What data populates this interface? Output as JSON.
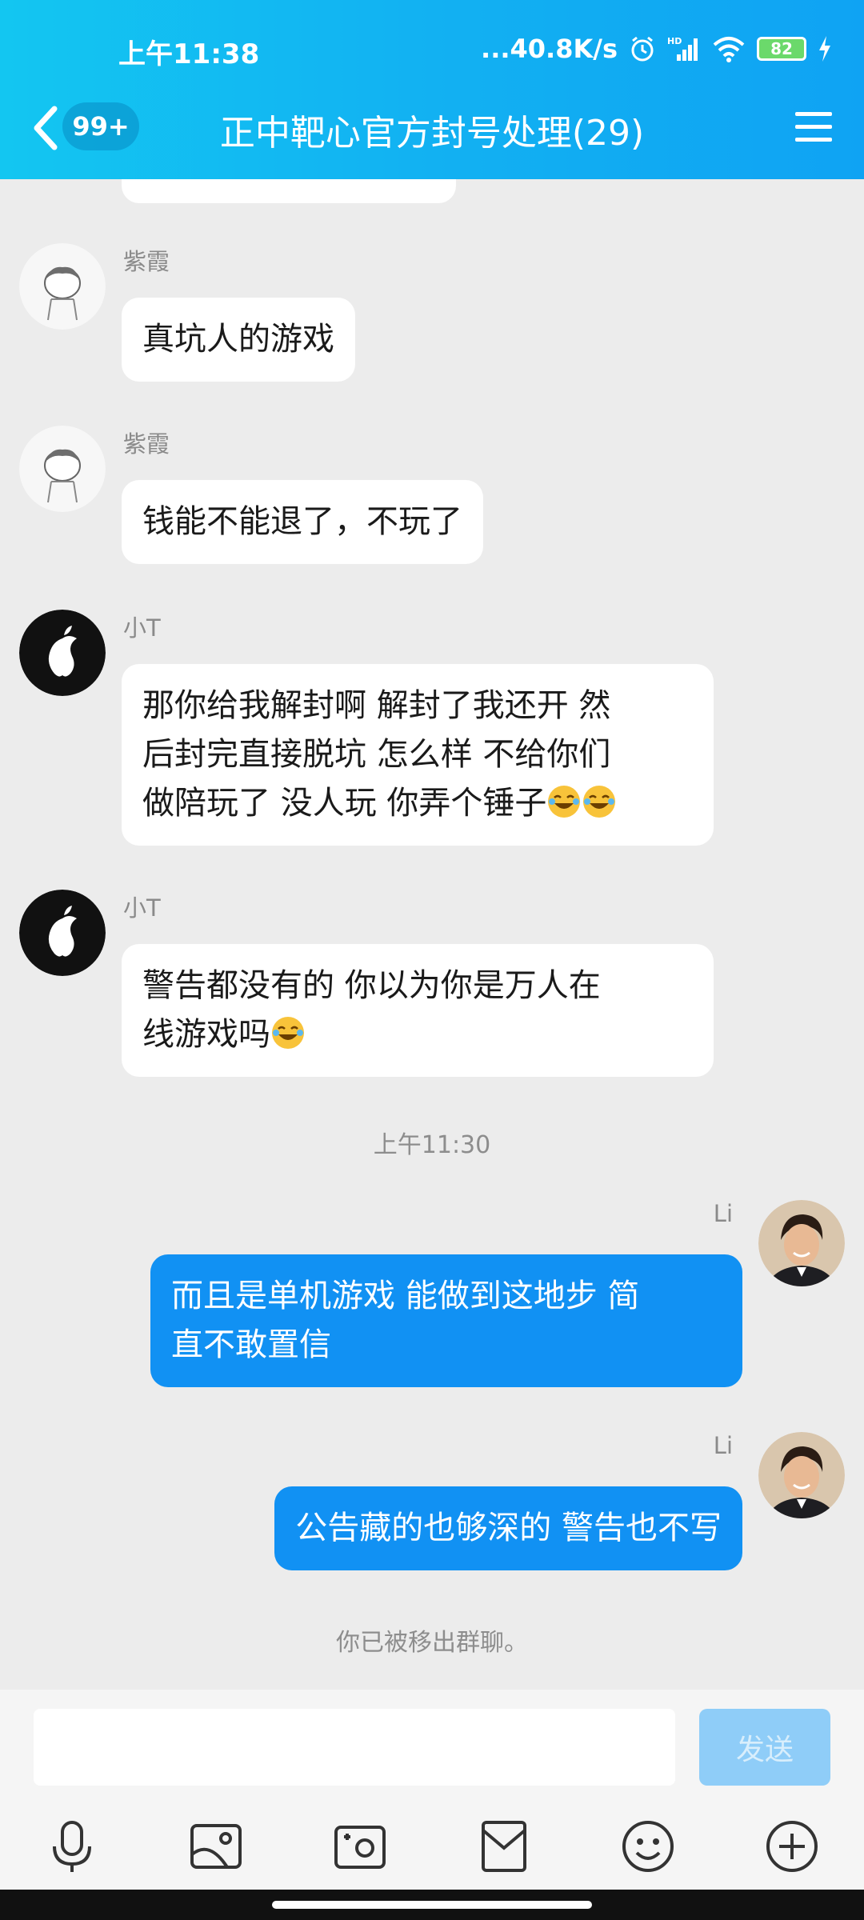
{
  "status_bar": {
    "time": "上午11:38",
    "network_speed": "...40.8K/s",
    "battery": "82"
  },
  "nav": {
    "unread_count": "99+",
    "title": "正中靶心官方封号处理(29)"
  },
  "messages": [
    {
      "sender": "紫霞",
      "text": "真坑人的游戏"
    },
    {
      "sender": "紫霞",
      "text": "钱能不能退了，不玩了"
    },
    {
      "sender": "小T",
      "lines": [
        "那你给我解封啊 解封了我还开 然",
        "后封完直接脱坑 怎么样 不给你们",
        "做陪玩了 没人玩 你弄个锤子"
      ]
    },
    {
      "sender": "小T",
      "lines": [
        "警告都没有的 你以为你是万人在",
        "线游戏吗"
      ]
    },
    {
      "sender": "Li",
      "lines": [
        "而且是单机游戏 能做到这地步 简",
        "直不敢置信"
      ]
    },
    {
      "sender": "Li",
      "text": "公告藏的也够深的 警告也不写"
    }
  ],
  "timestamp": "上午11:30",
  "system_note": "你已被移出群聊。",
  "input": {
    "value": "",
    "send_label": "发送"
  },
  "colors": {
    "header": "#12b1f2",
    "outgoing_bubble": "#1191f3",
    "incoming_bubble": "#ffffff"
  }
}
